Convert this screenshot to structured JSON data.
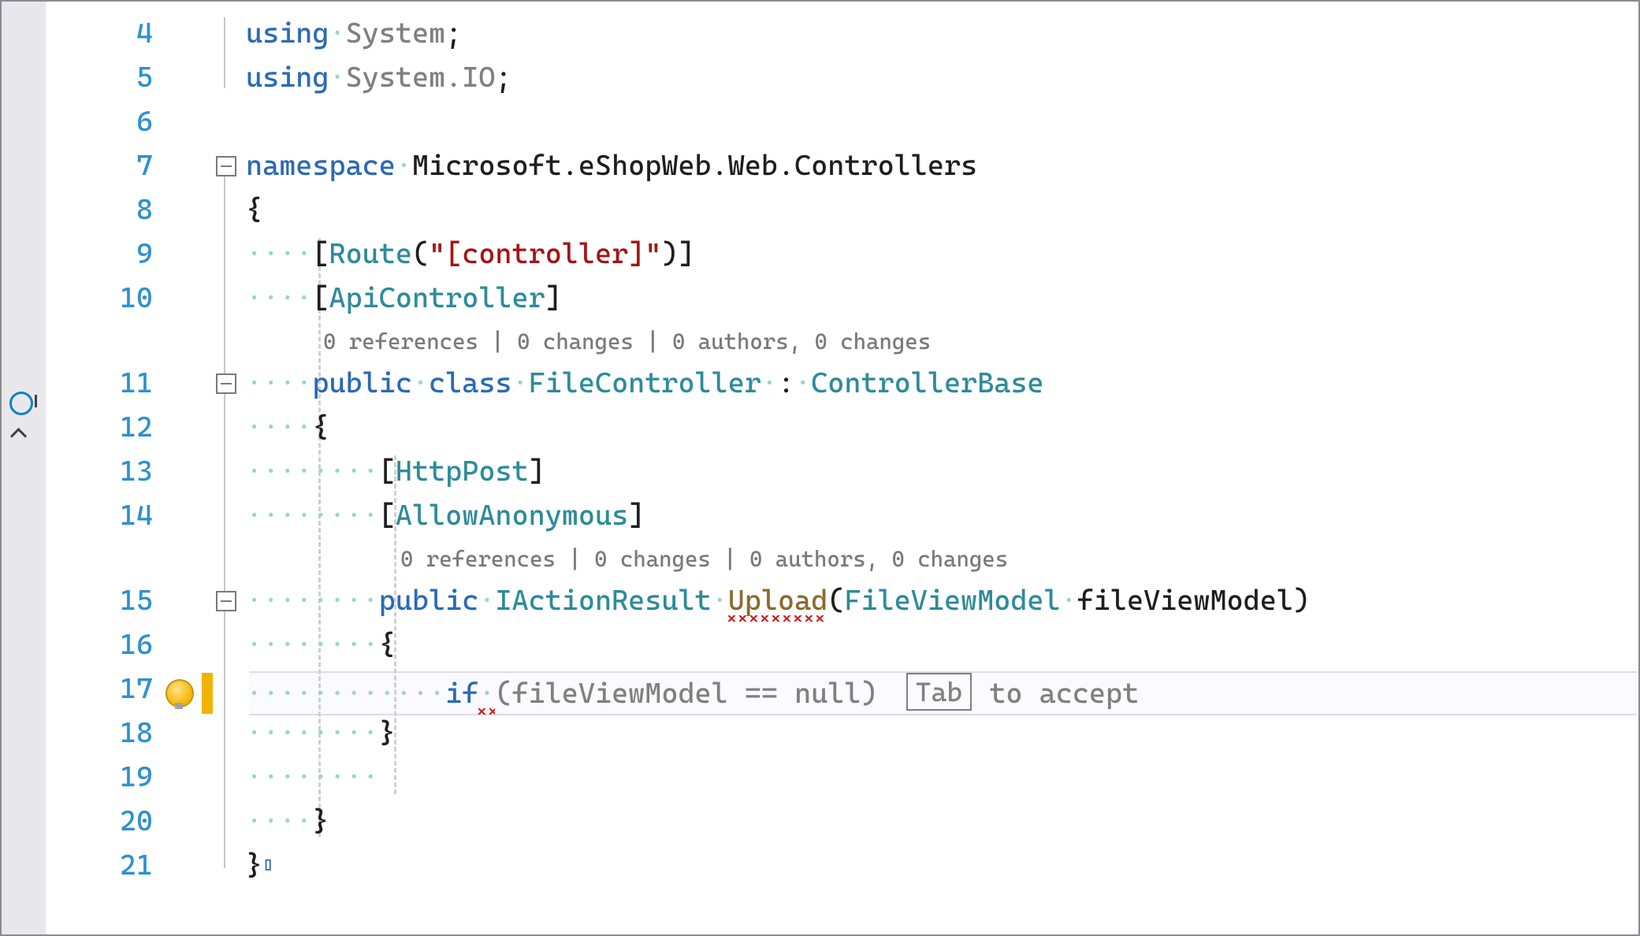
{
  "lines": {
    "4": {
      "num": "4"
    },
    "5": {
      "num": "5"
    },
    "6": {
      "num": "6"
    },
    "7": {
      "num": "7"
    },
    "8": {
      "num": "8"
    },
    "9": {
      "num": "9"
    },
    "10": {
      "num": "10"
    },
    "11": {
      "num": "11"
    },
    "12": {
      "num": "12"
    },
    "13": {
      "num": "13"
    },
    "14": {
      "num": "14"
    },
    "15": {
      "num": "15"
    },
    "16": {
      "num": "16"
    },
    "17": {
      "num": "17"
    },
    "18": {
      "num": "18"
    },
    "19": {
      "num": "19"
    },
    "20": {
      "num": "20"
    },
    "21": {
      "num": "21"
    }
  },
  "codelens1": "0 references | 0 changes | 0 authors, 0 changes",
  "codelens2": "0 references | 0 changes | 0 authors, 0 changes",
  "code": {
    "l4_using": "using",
    "l4_sp": "·",
    "l4_system": "System",
    "l4_semi": ";",
    "l5_using": "using",
    "l5_sp": "·",
    "l5_systemio": "System.IO",
    "l5_semi": ";",
    "l7_ns": "namespace",
    "l7_sp": "·",
    "l7_name": "Microsoft.eShopWeb.Web.Controllers",
    "l8_br": "{",
    "l9_dots": "····",
    "l9_lb": "[",
    "l9_route": "Route",
    "l9_lp": "(",
    "l9_str": "\"[controller]\"",
    "l9_rp": ")",
    "l9_rb": "]",
    "l10_dots": "····",
    "l10_lb": "[",
    "l10_api": "ApiController",
    "l10_rb": "]",
    "l11_dots": "····",
    "l11_public": "public",
    "l11_sp1": "·",
    "l11_class": "class",
    "l11_sp2": "·",
    "l11_fc": "FileController",
    "l11_sp3": "·",
    "l11_colon": ":",
    "l11_sp4": "·",
    "l11_base": "ControllerBase",
    "l12_dots": "····",
    "l12_br": "{",
    "l13_dots": "········",
    "l13_lb": "[",
    "l13_http": "HttpPost",
    "l13_rb": "]",
    "l14_dots": "········",
    "l14_lb": "[",
    "l14_anon": "AllowAnonymous",
    "l14_rb": "]",
    "l15_dots": "········",
    "l15_public": "public",
    "l15_sp1": "·",
    "l15_iar": "IActionResult",
    "l15_sp2": "·",
    "l15_upload": "Upload",
    "l15_lp": "(",
    "l15_fvm_t": "FileViewModel",
    "l15_sp3": "·",
    "l15_fvm_p": "fileViewModel",
    "l15_rp": ")",
    "l16_dots": "········",
    "l16_br": "{",
    "l17_dots": "············",
    "l17_if": "if",
    "l17_sp": "·",
    "l17_rest": "(fileViewModel == null)",
    "l17_tab": "Tab",
    "l17_accept": "to accept",
    "l18_dots": "········",
    "l18_br": "}",
    "l19_dots": "········",
    "l20_dots": "····",
    "l20_br": "}",
    "l21_br": "}"
  }
}
